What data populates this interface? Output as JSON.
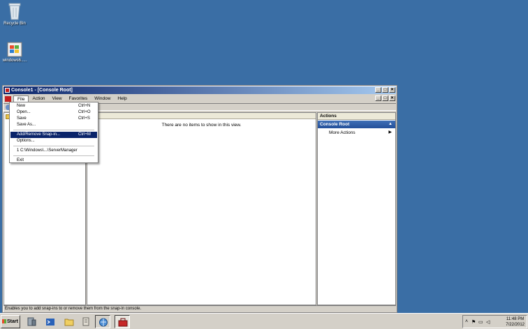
{
  "desktop": {
    "icons": [
      {
        "label": "Recycle Bin",
        "icon": "recycle-bin-icon"
      },
      {
        "label": "windows6.....",
        "icon": "file-icon"
      }
    ]
  },
  "window": {
    "title": "Console1 - [Console Root]",
    "controls": {
      "minimize": "_",
      "maximize": "□",
      "close": "✕"
    },
    "menu": [
      "File",
      "Action",
      "View",
      "Favorites",
      "Window",
      "Help"
    ],
    "file_menu": {
      "items": [
        {
          "label": "New",
          "shortcut": "Ctrl+N"
        },
        {
          "label": "Open...",
          "shortcut": "Ctrl+O"
        },
        {
          "label": "Save",
          "shortcut": "Ctrl+S"
        },
        {
          "label": "Save As...",
          "shortcut": ""
        },
        {
          "label": "Add/Remove Snap-in...",
          "shortcut": "Ctrl+M",
          "selected": true
        },
        {
          "label": "Options...",
          "shortcut": ""
        },
        {
          "label": "1 C:\\Windows\\...\\ServerManager",
          "shortcut": ""
        },
        {
          "label": "Exit",
          "shortcut": ""
        }
      ]
    },
    "center": {
      "empty_text": "There are no items to show in this view."
    },
    "actions": {
      "header": "Actions",
      "section": "Console Root",
      "items": [
        "More Actions"
      ]
    },
    "status": "Enables you to add snap-ins to or remove them from the snap-in console."
  },
  "taskbar": {
    "start_label": "Start",
    "clock": {
      "time": "11:48 PM",
      "date": "7/22/2012"
    }
  },
  "colors": {
    "desktop": "#3a6ea5",
    "title_start": "#0a246a",
    "title_end": "#a6caf0",
    "selection": "#0a246a",
    "action_section": "#2f5ea8"
  }
}
